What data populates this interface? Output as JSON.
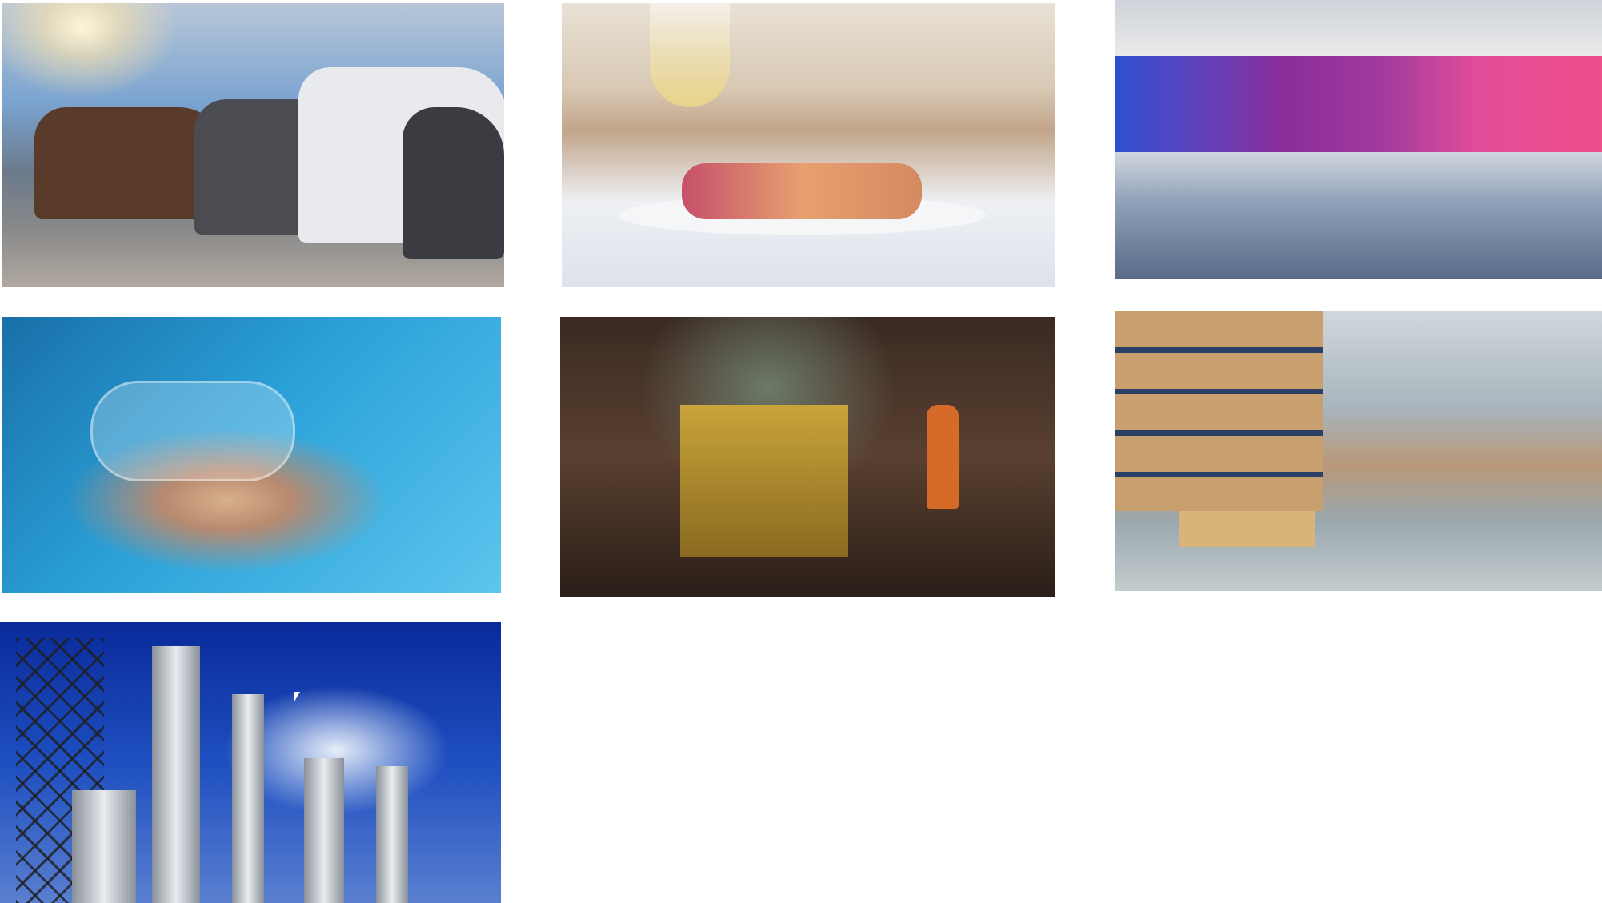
{
  "gallery": {
    "images": [
      {
        "subject": "cars",
        "accent": "#7aa3d0"
      },
      {
        "subject": "restaurant-dish",
        "accent": "#d8c8b4"
      },
      {
        "subject": "textile-spools",
        "accent": "#a23a9e"
      },
      {
        "subject": "pharmaceutical-pills",
        "accent": "#2aa0d8"
      },
      {
        "subject": "underground-mining",
        "accent": "#5a4030"
      },
      {
        "subject": "warehouse",
        "accent": "#a8b4bc"
      },
      {
        "subject": "industrial-plant",
        "accent": "#1e4fc0"
      }
    ]
  }
}
